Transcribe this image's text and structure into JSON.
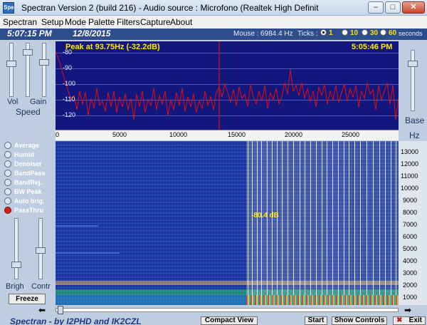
{
  "window": {
    "title": "Spectran Version 2 (build 216) - Audio source :  Microfono (Realtek High Definit",
    "icon_label": "Spe",
    "minimize_icon": "minimize-icon",
    "maximize_icon": "maximize-icon",
    "close_icon": "close-icon",
    "controls": [
      "–",
      "□",
      "✕"
    ]
  },
  "menu": [
    "Spectran",
    "Setup",
    "Mode",
    "Palette",
    "Filters",
    "Capture",
    "About"
  ],
  "status": {
    "time": "5:07:15 PM",
    "date": "12/8/2015",
    "mouse_label": "Mouse :",
    "mouse_value": "6984.4 Hz",
    "ticks_label": "Ticks :",
    "ticks": [
      "1",
      "10",
      "30",
      "60"
    ],
    "ticks_selected": "1",
    "seconds_label": "seconds"
  },
  "side": {
    "vol_label": "Vol",
    "gain_label": "Gain",
    "speed_label": "Speed",
    "brigh_label": "Brigh",
    "contr_label": "Contr",
    "freeze_label": "Freeze",
    "options": [
      {
        "label": "Average",
        "on": false
      },
      {
        "label": "Humid",
        "on": false
      },
      {
        "label": "Denoiser",
        "on": false
      },
      {
        "label": "BandPass",
        "on": false
      },
      {
        "label": "BandRej.",
        "on": false
      },
      {
        "label": "BW Peak",
        "on": false
      },
      {
        "label": "Auto brig.",
        "on": false
      },
      {
        "label": "PassThru",
        "on": true
      }
    ]
  },
  "right": {
    "base_label": "Base",
    "hz_label": "Hz"
  },
  "spectrum": {
    "peak_text": "Peak at    93.75Hz (-32.2dB)",
    "time": "5:05:46 PM",
    "y_labels": [
      "-80",
      "-90",
      "-100",
      "-110",
      "-120"
    ],
    "x_labels": [
      "0",
      "5000",
      "10000",
      "15000",
      "20000",
      "25000"
    ]
  },
  "waterfall": {
    "db_label": "-80.4 dB",
    "freq_labels": [
      "13000",
      "12000",
      "11000",
      "10000",
      "9000",
      "8000",
      "7000",
      "6000",
      "5000",
      "4000",
      "3000",
      "2000",
      "1000"
    ]
  },
  "buttons": {
    "compact_view": "Compact View",
    "start": "Start",
    "show_controls": "Show Controls",
    "exit": "Exit"
  },
  "credits": "Spectran - by I2PHD and IK2CZL",
  "colors": {
    "spectrum_bg": "#13167c",
    "trace": "#e01010",
    "waterfall_bg": "#1c37a4",
    "label_yellow": "#ffea00"
  }
}
